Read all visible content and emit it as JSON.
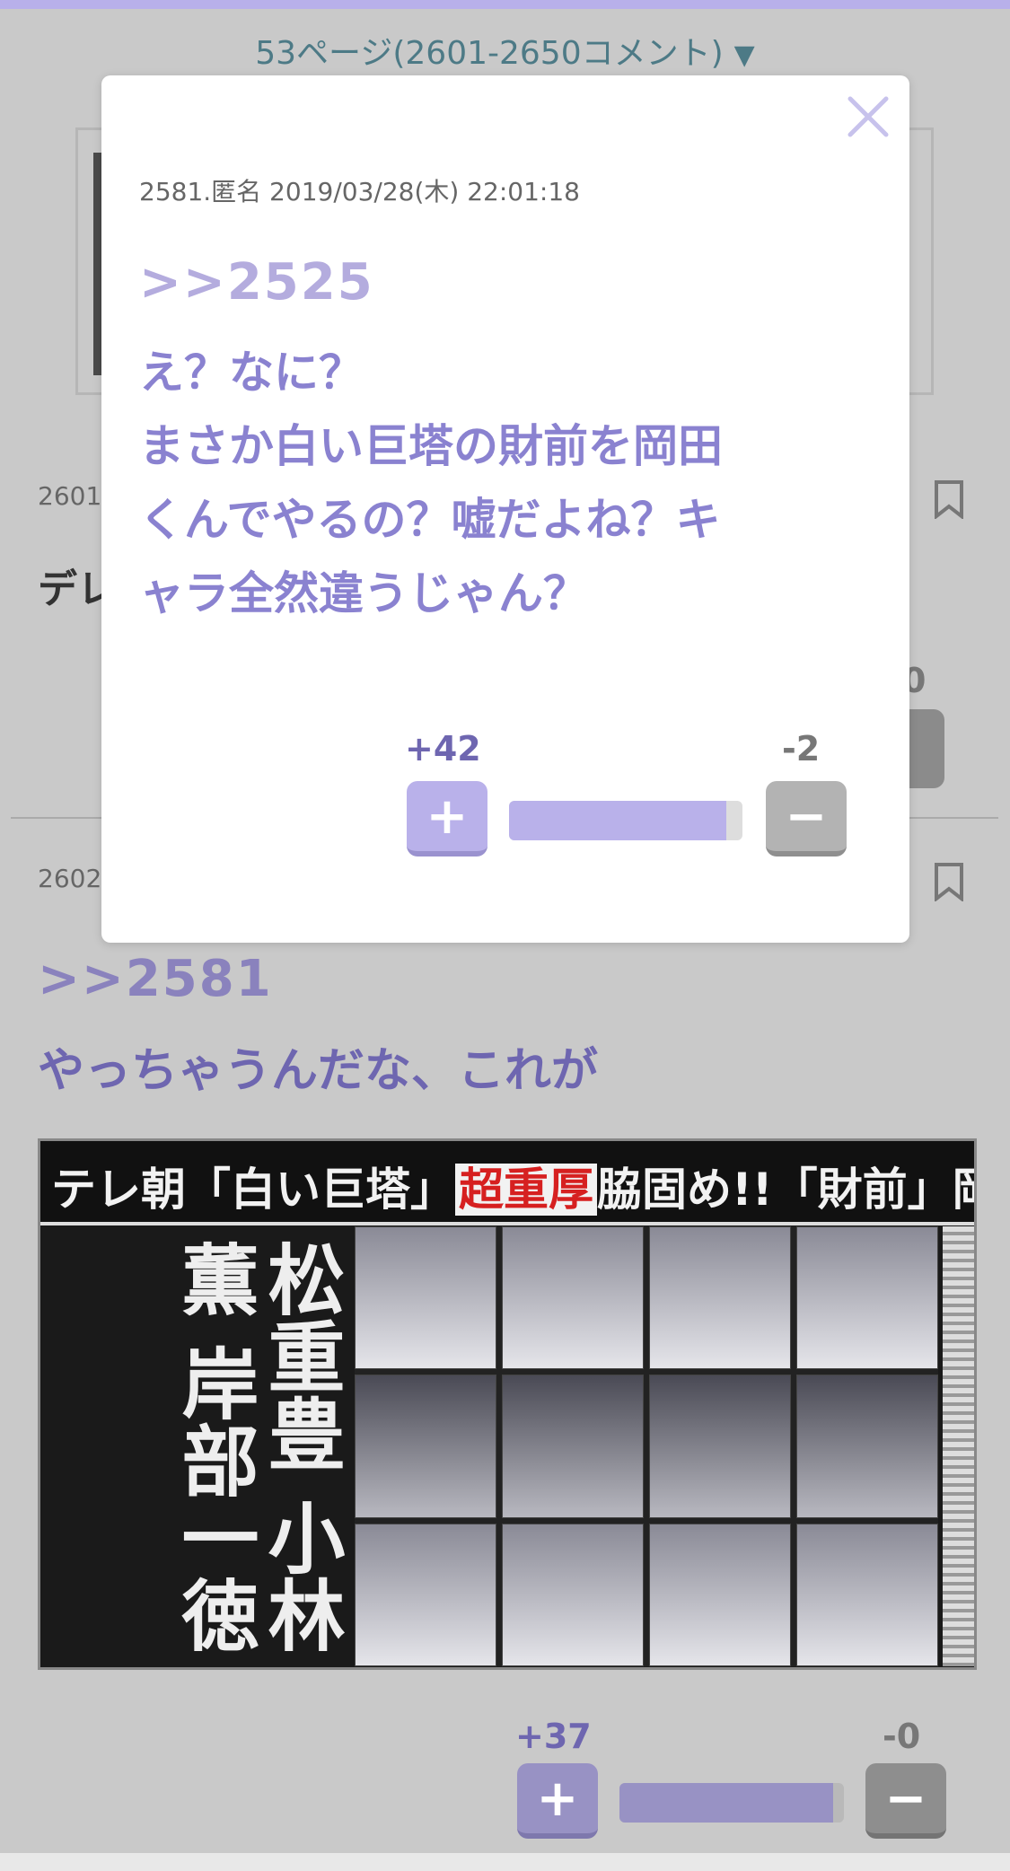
{
  "page_nav": {
    "label": "53ページ(2601-2650コメント)",
    "arrow": "▼"
  },
  "background": {
    "comment_2601": {
      "meta": "2601",
      "title_fragment": "デレ",
      "minus_count_fragment": "0"
    },
    "comment_2602": {
      "meta": "2602",
      "quote": ">>2581",
      "body": "やっちゃうんだな、これが",
      "image": {
        "headline_pre": "テレ朝「白い巨塔」",
        "headline_red": "超重厚",
        "headline_post": "脇固め!!「財前」岡田「とてもうれしい」",
        "names": "松重豊 小林薫 岸部一徳"
      },
      "votes": {
        "plus": "+37",
        "minus": "-0",
        "plus_ratio": 0.95
      }
    }
  },
  "modal": {
    "meta": "2581.匿名 2019/03/28(木) 22:01:18",
    "quote": ">>2525",
    "body_lines": [
      "え？なに？",
      "まさか白い巨塔の財前を岡田",
      "くんでやるの？嘘だよね？キ",
      "ャラ全然違うじゃん？"
    ],
    "votes": {
      "plus": "+42",
      "minus": "-2",
      "plus_ratio": 0.93
    },
    "plus_glyph": "+",
    "minus_glyph": "−"
  },
  "colors": {
    "accent": "#b9b1ea",
    "text_accent": "#8a82d0",
    "overlay": "#c9c9c9"
  },
  "icons": [
    "close-icon",
    "bookmark-icon",
    "chevron-down-icon"
  ]
}
